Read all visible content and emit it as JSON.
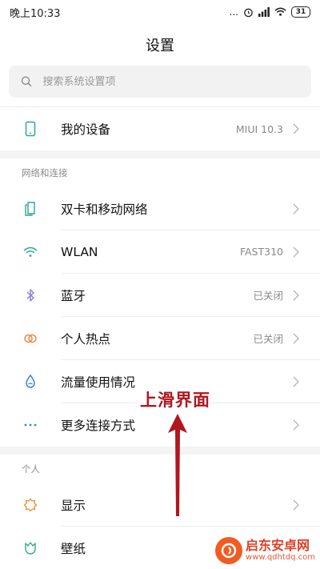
{
  "status_bar": {
    "time": "晚上10:33",
    "signal_dots": "...",
    "battery": "31"
  },
  "header": {
    "title": "设置"
  },
  "search": {
    "placeholder": "搜索系统设置项"
  },
  "device_row": {
    "label": "我的设备",
    "value": "MIUI 10.3"
  },
  "sections": {
    "network_title": "网络和连接",
    "personal_title": "个人"
  },
  "network_items": [
    {
      "label": "双卡和移动网络",
      "value": ""
    },
    {
      "label": "WLAN",
      "value": "FAST310"
    },
    {
      "label": "蓝牙",
      "value": "已关闭"
    },
    {
      "label": "个人热点",
      "value": "已关闭"
    },
    {
      "label": "流量使用情况",
      "value": ""
    },
    {
      "label": "更多连接方式",
      "value": ""
    }
  ],
  "personal_items": [
    {
      "label": "显示"
    },
    {
      "label": "壁纸"
    }
  ],
  "annotation": {
    "text": "上滑界面"
  },
  "watermark": {
    "title": "启东安卓网",
    "url": "www.qdhtdq.com"
  },
  "colors": {
    "accent_teal": "#2ea69a",
    "bluetooth_purple": "#8a7bd8",
    "hotspot_orange": "#f0874a",
    "data_blue": "#3b87c9",
    "annotation_red": "#b1161f",
    "display_orange": "#f08a2c",
    "wallpaper_green": "#2fae7c"
  }
}
